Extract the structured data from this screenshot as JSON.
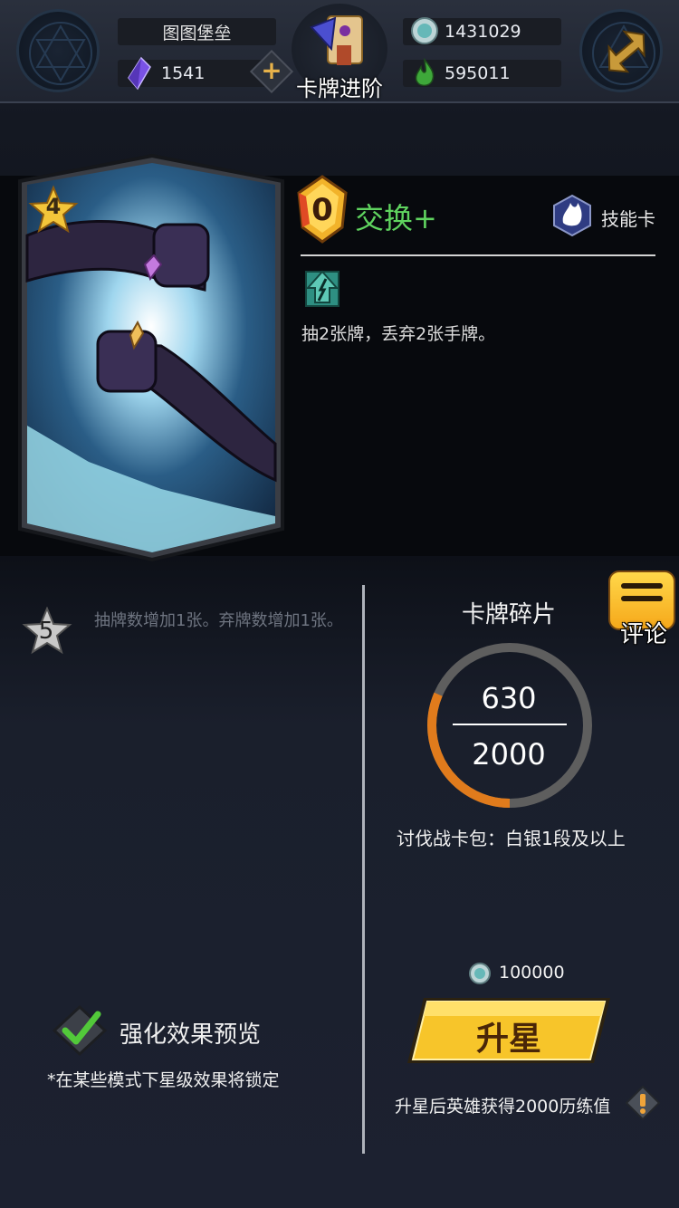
{
  "header": {
    "player_title": "图图堡垒",
    "crystal_count": "1541",
    "coin_count": "1431029",
    "gem_count": "595011",
    "page_title": "卡牌进阶"
  },
  "card": {
    "star": "4",
    "cost": "0",
    "name": "交换+",
    "type": "技能卡",
    "description": "抽2张牌，丢弃2张手牌。"
  },
  "upgrade_level": {
    "star": "5",
    "effect": "抽牌数增加1张。弃牌数增加1张。"
  },
  "preview": {
    "label": "强化效果预览",
    "note": "*在某些模式下星级效果将锁定"
  },
  "fragments": {
    "title": "卡牌碎片",
    "current": "630",
    "required": "2000",
    "progress": 0.315,
    "source": "讨伐战卡包：白银1段及以上"
  },
  "comment_button": "评论",
  "upgrade": {
    "cost": "100000",
    "button_label": "升星",
    "bonus": "升星后英雄获得2000历练值"
  },
  "colors": {
    "card_name": "#5fd35f",
    "button_gold": "#f7c52a",
    "ring_progress": "#e07b1c",
    "ring_track": "#5e5e5e"
  }
}
